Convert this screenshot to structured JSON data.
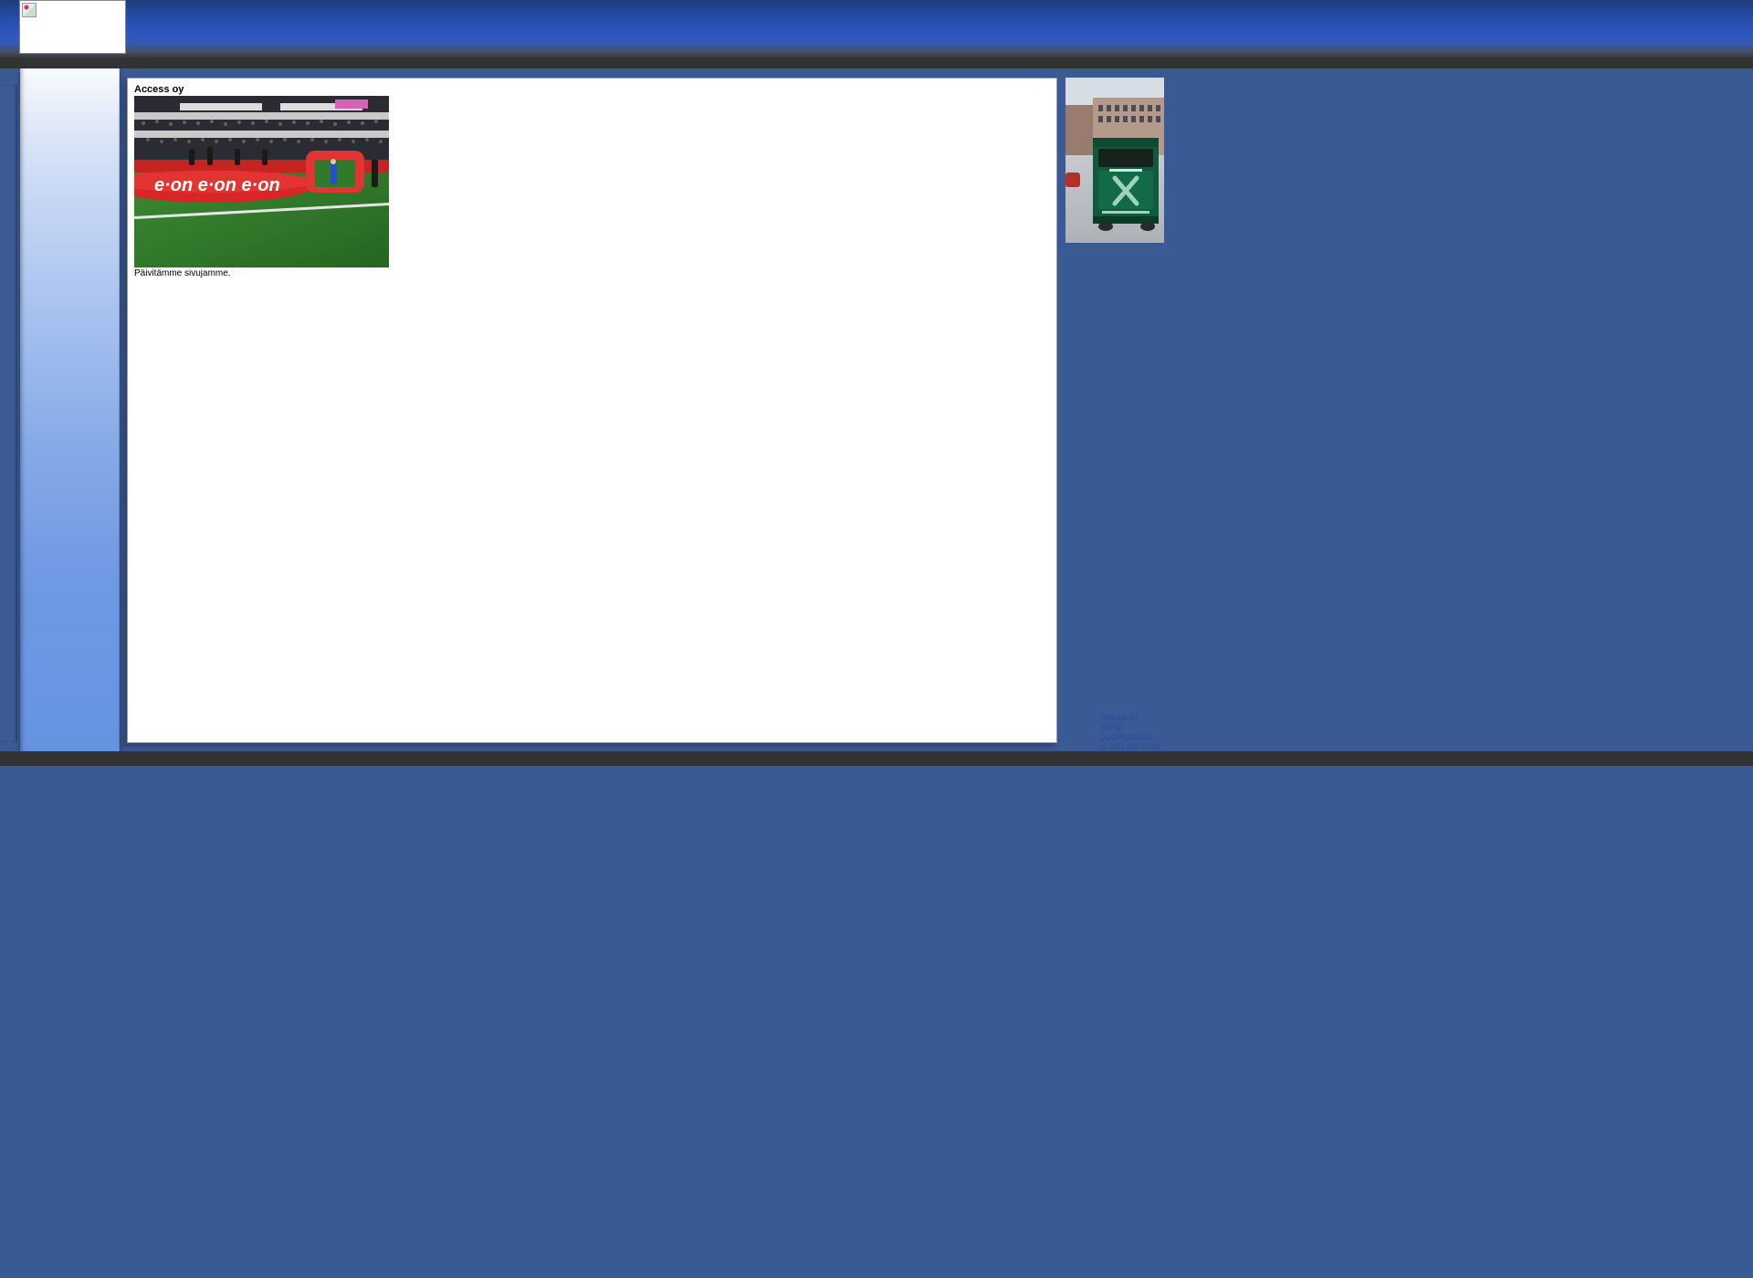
{
  "header": {
    "logo_alt": "logo"
  },
  "panel": {
    "title": "Access oy",
    "body": "Päivitämme sivujamme."
  },
  "contact": {
    "line1": "Retkitie 13",
    "line2": "36760 LUOPIOINEN",
    "line3": "p. (02) 487 5799"
  }
}
